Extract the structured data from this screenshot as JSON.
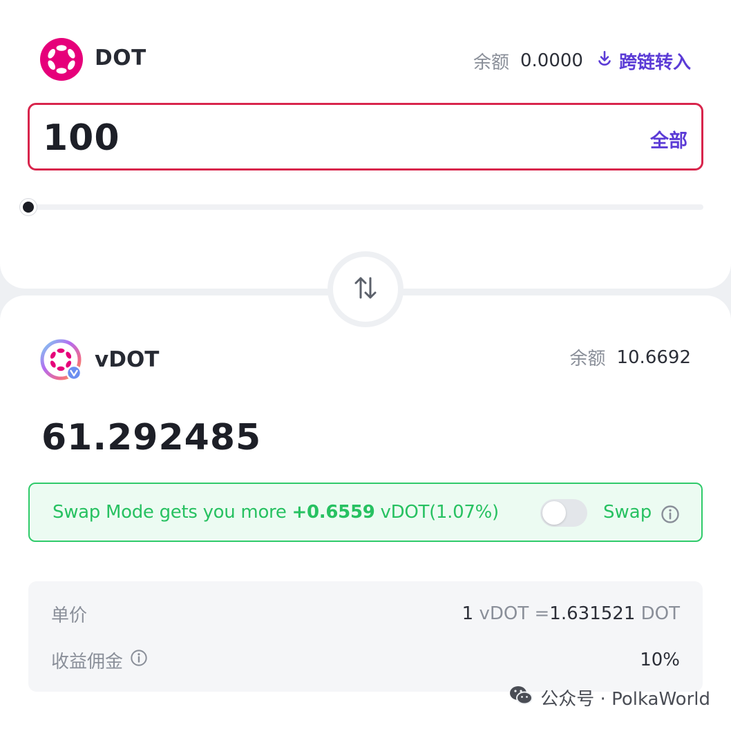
{
  "from_token": {
    "symbol": "DOT",
    "balance_label": "余额",
    "balance_value": "0.0000",
    "cross_chain_label": "跨链转入",
    "logo_color": "#e6007a"
  },
  "amount_input": {
    "value": "100",
    "max_label": "全部",
    "border_color": "#d8254c"
  },
  "slider": {
    "percent": 0
  },
  "swap_direction_icon": "swap-vertical-arrows-icon",
  "to_token": {
    "symbol": "vDOT",
    "balance_label": "余额",
    "balance_value": "10.6692",
    "output_value": "61.292485"
  },
  "swap_mode": {
    "prefix": "Swap Mode gets you more ",
    "bonus": "+0.6559",
    "suffix": " vDOT(1.07%)",
    "toggle_label": "Swap",
    "toggle_on": false,
    "accent_color": "#27c161"
  },
  "details": {
    "price_label": "单价",
    "price_left_num": "1",
    "price_left_unit": "vDOT",
    "price_eq": "=",
    "price_right_num": "1.631521",
    "price_right_unit": "DOT",
    "commission_label": "收益佣金",
    "commission_value": "10%"
  },
  "watermark": {
    "text": "公众号 · PolkaWorld"
  },
  "colors": {
    "accent_purple": "#5b3bd6",
    "background": "#eef0f3"
  }
}
